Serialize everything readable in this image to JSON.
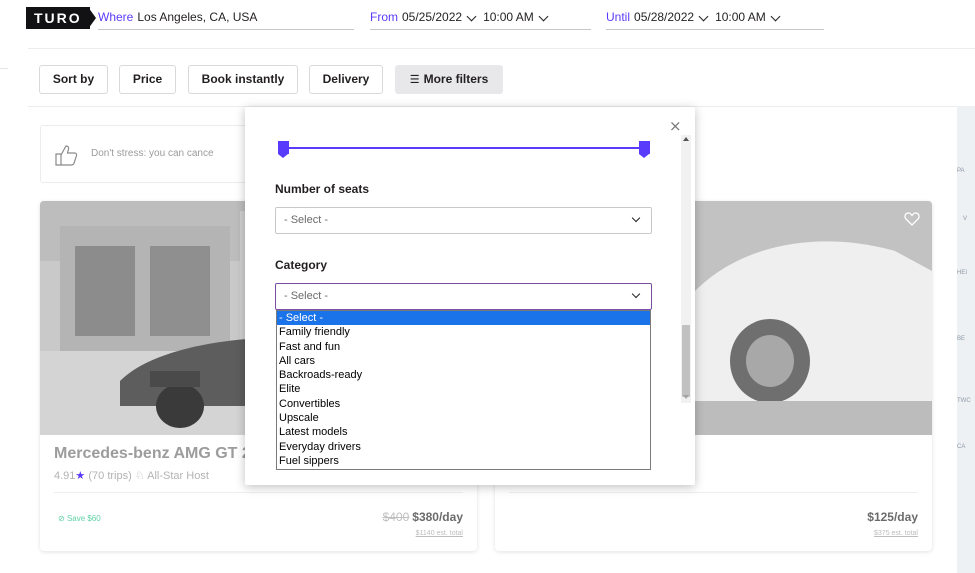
{
  "header": {
    "logo": "TURO",
    "where_label": "Where",
    "where_value": "Los Angeles, CA, USA",
    "from_label": "From",
    "from_date": "05/25/2022",
    "from_time": "10:00 AM",
    "until_label": "Until",
    "until_date": "05/28/2022",
    "until_time": "10:00 AM"
  },
  "filters": {
    "sort_by": "Sort by",
    "price": "Price",
    "book_instantly": "Book instantly",
    "delivery": "Delivery",
    "more_filters": "More filters"
  },
  "notice": {
    "text": "Don't stress: you can cance"
  },
  "cards": [
    {
      "title": "Mercedes-benz AMG GT 2",
      "rating": "4.91",
      "trips": "(70 trips)",
      "host": "All-Star Host",
      "save": "Save $60",
      "old_price": "$400",
      "price": "$380/day",
      "total": "$1140 est. total"
    },
    {
      "price": "$125/day",
      "total": "$375 est. total"
    }
  ],
  "map_labels": [
    "PA",
    "V",
    "HEI",
    "BE",
    "TWC",
    "CA"
  ],
  "panel": {
    "seats_title": "Number of seats",
    "seats_value": "- Select -",
    "category_title": "Category",
    "category_value": "- Select -",
    "category_options": [
      "- Select -",
      "Family friendly",
      "Fast and fun",
      "All cars",
      "Backroads-ready",
      "Elite",
      "Convertibles",
      "Upscale",
      "Latest models",
      "Everyday drivers",
      "Fuel sippers"
    ],
    "selected_index": 0,
    "close_symbol": "×"
  },
  "colors": {
    "brand_purple": "#593cfb",
    "selection_blue": "#1a73e8",
    "save_green": "#5fd1a5"
  }
}
